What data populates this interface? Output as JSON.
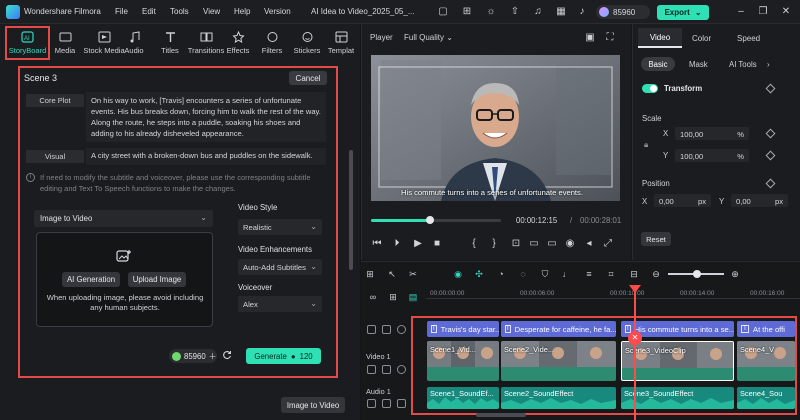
{
  "app": {
    "title": "Wondershare Filmora",
    "project": "AI Idea to Video_2025_05_...",
    "credits": "85960",
    "export_label": "Export"
  },
  "menu": [
    "File",
    "Edit",
    "Tools",
    "View",
    "Help",
    "Version"
  ],
  "toolbar": [
    {
      "label": "StoryBoard",
      "icon": "storyboard-icon"
    },
    {
      "label": "Media",
      "icon": "media-icon"
    },
    {
      "label": "Stock Media",
      "icon": "stock-media-icon"
    },
    {
      "label": "Audio",
      "icon": "audio-icon"
    },
    {
      "label": "Titles",
      "icon": "titles-icon"
    },
    {
      "label": "Transitions",
      "icon": "transitions-icon"
    },
    {
      "label": "Effects",
      "icon": "effects-icon"
    },
    {
      "label": "Filters",
      "icon": "filters-icon"
    },
    {
      "label": "Stickers",
      "icon": "stickers-icon"
    },
    {
      "label": "Templat",
      "icon": "templates-icon"
    }
  ],
  "storyboard": {
    "scene_title": "Scene 3",
    "cancel_label": "Cancel",
    "core_plot_label": "Core Plot",
    "core_plot_text": "On his way to work, [Travis] encounters a series of unfortunate events. His bus breaks down, forcing him to walk the rest of the way. Along the route, he steps into a puddle, soaking his shoes and adding to his already disheveled appearance.",
    "visual_label": "Visual",
    "visual_text": "A city street with a broken-down bus and puddles on the sidewalk.",
    "info_note": "If need to modify the subtitle and voiceover, please use the corresponding subtitle editing and Text To Speech functions to make the changes.",
    "mode_value": "Image to Video",
    "ai_generation_label": "AI Generation",
    "upload_image_label": "Upload Image",
    "upload_note": "When uploading image, please avoid including any human subjects.",
    "video_style_label": "Video Style",
    "video_style_value": "Realistic",
    "video_enh_label": "Video Enhancements",
    "video_enh_value": "Auto-Add Subtitles",
    "voiceover_label": "Voiceover",
    "voiceover_value": "Alex",
    "credit_count": "85960",
    "generate_label": "Generate",
    "generate_cost": "120",
    "image_to_video_label": "Image to Video"
  },
  "player": {
    "label": "Player",
    "quality": "Full Quality",
    "caption": "His commute turns into a series of unfortunate events.",
    "current_time": "00:00:12:15",
    "separator": "/",
    "total_time": "00:00:28:01",
    "progress": 0.45
  },
  "properties": {
    "tabs": [
      "Video",
      "Color",
      "Speed"
    ],
    "subtabs": [
      "Basic",
      "Mask",
      "AI Tools"
    ],
    "transform_label": "Transform",
    "scale_label": "Scale",
    "x_label": "X",
    "y_label": "Y",
    "scale_x": "100,00",
    "scale_y": "100,00",
    "pct": "%",
    "position_label": "Position",
    "pos_x": "0,00",
    "pos_y": "0,00",
    "px": "px",
    "reset_label": "Reset"
  },
  "timeline": {
    "ticks": [
      "00:00:00:00",
      "00:00:06:00",
      "00:00:10:00",
      "00:00:14:00",
      "00:00:16:00"
    ],
    "video_track_label": "Video 1",
    "audio_track_label": "Audio 1",
    "subtitles": [
      "Travis's day star...",
      "Desperate for caffeine, he fa...",
      "His commute turns into a se...",
      "At the offi"
    ],
    "video_clips": [
      "Scene1_Vid...",
      "Scene2_Vide...",
      "Scene3_VideoClip",
      "Scene4_V"
    ],
    "audio_clips": [
      "Scene1_SoundEf...",
      "Scene2_SoundEffect",
      "Scene3_SoundEffect",
      "Scene4_Sou"
    ]
  }
}
